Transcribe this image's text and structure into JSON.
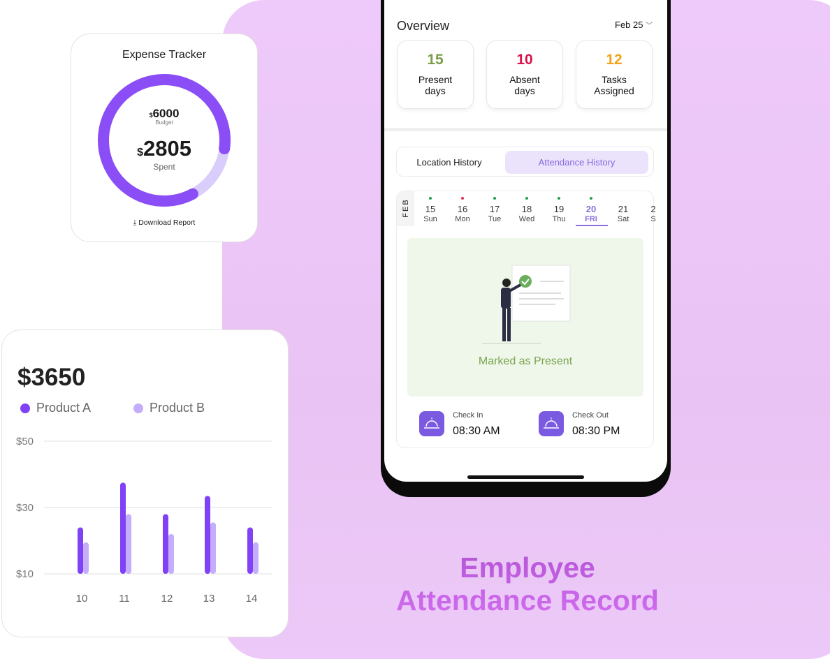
{
  "expense": {
    "title": "Expense Tracker",
    "budget_symbol": "$",
    "budget": "6000",
    "budget_label": "Budget",
    "spent_symbol": "$",
    "spent": "2805",
    "spent_label": "Spent",
    "download": "Download Report",
    "icon": "download-icon",
    "ring_colors": {
      "spent": "#8b4df5",
      "remaining": "#d9cdfb"
    }
  },
  "sales": {
    "total": "$3650",
    "legend": [
      {
        "name": "Product A",
        "color": "#8142f5"
      },
      {
        "name": "Product B",
        "color": "#c4aefb"
      }
    ]
  },
  "chart_data": {
    "type": "bar",
    "categories": [
      "10",
      "11",
      "12",
      "13",
      "14"
    ],
    "series": [
      {
        "name": "Product A",
        "values": [
          24,
          37.5,
          28,
          33.5,
          24
        ]
      },
      {
        "name": "Product B",
        "values": [
          19.5,
          28,
          22,
          25.5,
          19.5
        ]
      }
    ],
    "yticks": [
      "$50",
      "$30",
      "$10"
    ],
    "ylim": [
      10,
      50
    ],
    "grid": true,
    "legend": "top-left"
  },
  "overview": {
    "title": "Overview",
    "period": "Feb 25",
    "stats": [
      {
        "value": "15",
        "label1": "Present",
        "label2": "days",
        "color": "#7a9e4a"
      },
      {
        "value": "10",
        "label1": "Absent",
        "label2": "days",
        "color": "#d8124a"
      },
      {
        "value": "12",
        "label1": "Tasks",
        "label2": "Assigned",
        "color": "#f2a41c"
      }
    ]
  },
  "tabs": [
    {
      "label": "Location History",
      "active": false
    },
    {
      "label": "Attendance History",
      "active": true
    }
  ],
  "calendar": {
    "month": "FEB",
    "days": [
      {
        "d": "15",
        "w": "Sun",
        "dot": "#22a04b"
      },
      {
        "d": "16",
        "w": "Mon",
        "dot": "#e0325a"
      },
      {
        "d": "17",
        "w": "Tue",
        "dot": "#22a04b"
      },
      {
        "d": "18",
        "w": "Wed",
        "dot": "#22a04b"
      },
      {
        "d": "19",
        "w": "Thu",
        "dot": "#22a04b"
      },
      {
        "d": "20",
        "w": "FRI",
        "dot": "#22a04b",
        "selected": true
      },
      {
        "d": "21",
        "w": "Sat",
        "dot": ""
      },
      {
        "d": "2",
        "w": "S",
        "dot": ""
      }
    ]
  },
  "status": {
    "text": "Marked as Present",
    "color": "#7aa550"
  },
  "check_in": {
    "label": "Check In",
    "time": "08:30 AM"
  },
  "check_out": {
    "label": "Check Out",
    "time": "08:30 PM"
  },
  "headline": {
    "line1": "Employee",
    "line2": "Attendance Record"
  }
}
